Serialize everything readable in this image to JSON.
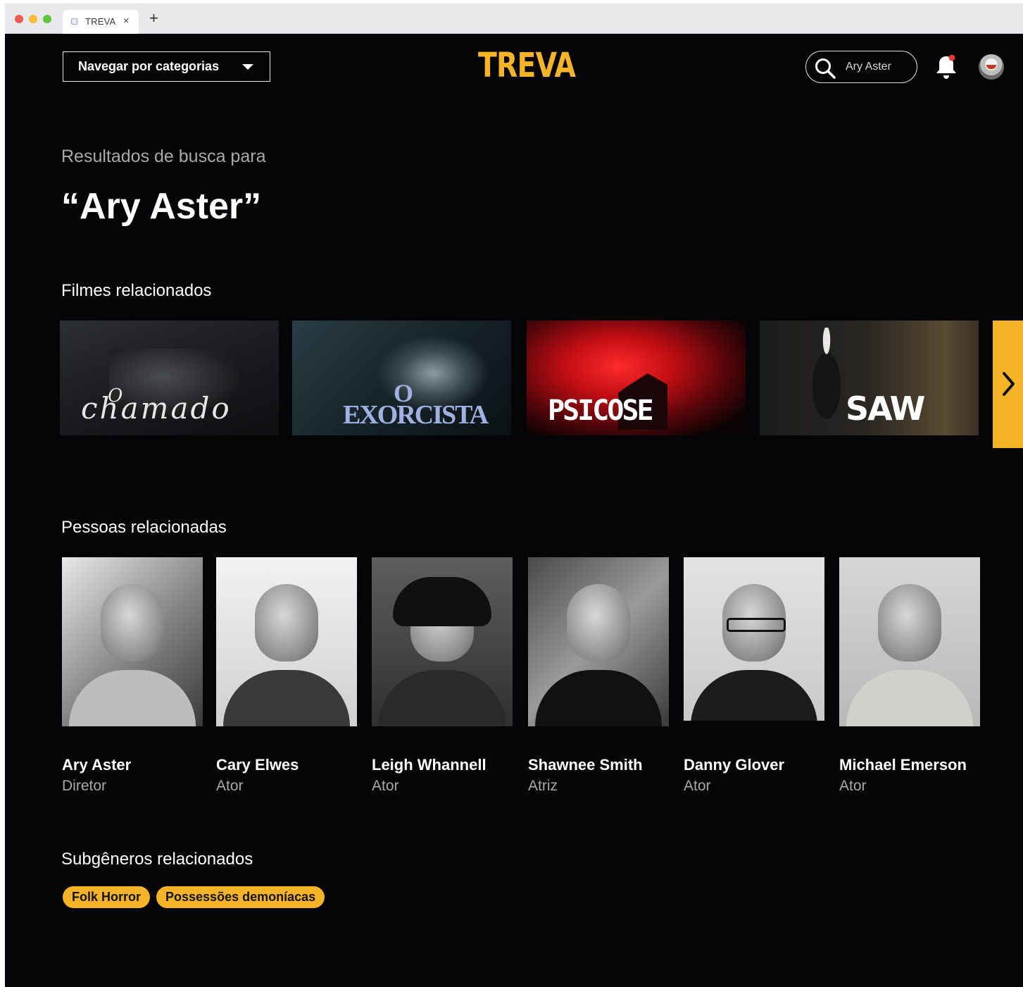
{
  "browser": {
    "tab_title": "TREVA",
    "tab_close": "×",
    "new_tab": "+"
  },
  "header": {
    "category_label": "Navegar por categorias",
    "logo": "TREVA",
    "search_value": "Ary Aster",
    "search_placeholder": "Ary Aster"
  },
  "results": {
    "label": "Resultados de busca para",
    "query": "“Ary Aster”"
  },
  "sections": {
    "movies_title": "Filmes relacionados",
    "people_title": "Pessoas relacionadas",
    "subgenres_title": "Subgêneros relacionados"
  },
  "movies": [
    {
      "title_prefix": "O",
      "title": "chamado"
    },
    {
      "title_prefix": "O",
      "title": "EXORCISTA"
    },
    {
      "title_prefix": "",
      "title": "PSICOSE"
    },
    {
      "title_prefix": "",
      "title": "SAW"
    }
  ],
  "people": [
    {
      "name": "Ary Aster",
      "role": "Diretor"
    },
    {
      "name": "Cary Elwes",
      "role": "Ator"
    },
    {
      "name": "Leigh Whannell",
      "role": "Ator"
    },
    {
      "name": "Shawnee Smith",
      "role": "Atriz"
    },
    {
      "name": "Danny Glover",
      "role": "Ator"
    },
    {
      "name": "Michael Emerson",
      "role": "Ator"
    }
  ],
  "subgenres": [
    "Folk Horror",
    "Possessões demoníacas"
  ],
  "icons": {
    "search": "search-icon",
    "notification": "bell-icon",
    "next": "chevron-right-icon",
    "dropdown": "caret-down-icon"
  },
  "colors": {
    "background": "#050508",
    "accent": "#f5b427",
    "notification_dot": "#e03a3a"
  }
}
